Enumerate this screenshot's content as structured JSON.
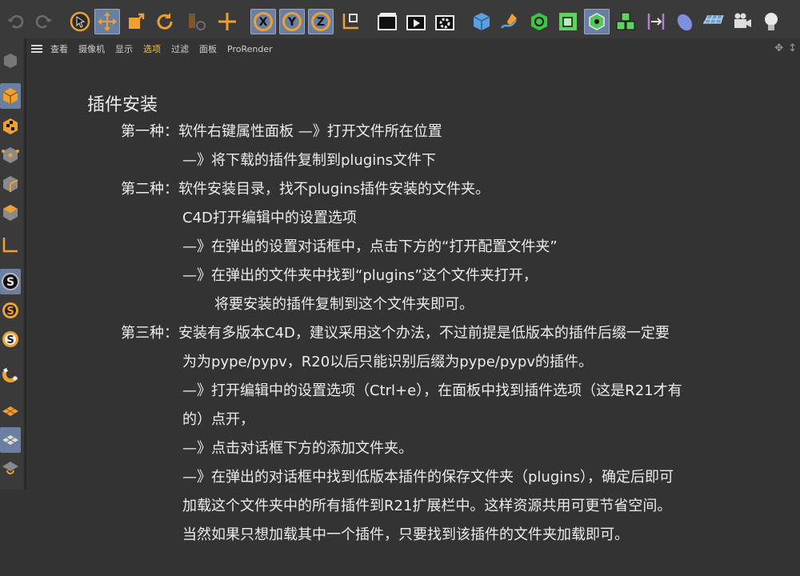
{
  "menu": {
    "items": [
      {
        "label": "查看",
        "active": false
      },
      {
        "label": "摄像机",
        "active": false
      },
      {
        "label": "显示",
        "active": false
      },
      {
        "label": "选项",
        "active": true
      },
      {
        "label": "过滤",
        "active": false
      },
      {
        "label": "面板",
        "active": false
      },
      {
        "label": "ProRender",
        "active": false
      }
    ]
  },
  "toolbar": {
    "icons": [
      "undo-icon",
      "redo-icon",
      "live-selection-icon",
      "move-icon",
      "scale-icon",
      "rotate-icon",
      "recent-tool-icon",
      "add-icon",
      "x-axis-lock-icon",
      "y-axis-lock-icon",
      "z-axis-lock-icon",
      "coordinate-system-icon",
      "render-view-icon",
      "render-picture-viewer-icon",
      "render-settings-icon",
      "cube-icon",
      "pen-spline-icon",
      "subdivision-object-icon",
      "extrude-object-icon",
      "cloner-icon",
      "mograph-cloner-icon",
      "deformer-bend-icon",
      "field-icon",
      "floor-icon",
      "camera-icon",
      "light-icon"
    ],
    "accent": "#f0a030",
    "selected_color": "#6b7fa3"
  },
  "leftdock": {
    "icons": [
      "make-editable-icon",
      "model-mode-icon",
      "texture-mode-icon",
      "point-mode-icon",
      "edge-mode-icon",
      "polygon-mode-icon",
      "axis-mode-icon",
      "snap-icon",
      "snap-settings-icon",
      "snap-enable-icon",
      "magnet-icon",
      "workplane-icon",
      "grid-icon",
      "quantize-icon"
    ]
  },
  "doc": {
    "title": "插件安装",
    "lines": [
      "第一种：软件右键属性面板 —》打开文件所在位置",
      "—》将下载的插件复制到plugins文件下",
      "第二种：软件安装目录，找不plugins插件安装的文件夹。",
      "C4D打开编辑中的设置选项",
      "—》在弹出的设置对话框中，点击下方的“打开配置文件夹”",
      "—》在弹出的文件夹中找到“plugins”这个文件夹打开，",
      "将要安装的插件复制到这个文件夹即可。",
      "第三种：安装有多版本C4D，建议采用这个办法，不过前提是低版本的插件后缀一定要",
      "为为pype/pypv，R20以后只能识别后缀为pype/pypv的插件。",
      "—》打开编辑中的设置选项（Ctrl+e），在面板中找到插件选项（这是R21才有",
      "的）点开，",
      "—》点击对话框下方的添加文件夹。",
      "—》在弹出的对话框中找到低版本插件的保存文件夹（plugins），确定后即可",
      "加载这个文件夹中的所有插件到R21扩展栏中。这样资源共用可更节省空间。",
      "当然如果只想加载其中一个插件，只要找到该插件的文件夹加载即可。"
    ]
  }
}
